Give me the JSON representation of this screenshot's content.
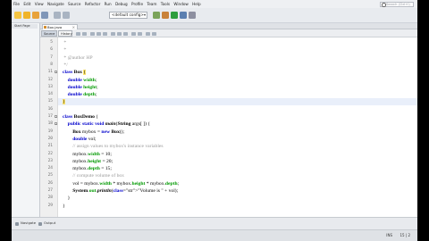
{
  "menu": [
    "File",
    "Edit",
    "View",
    "Navigate",
    "Source",
    "Refactor",
    "Run",
    "Debug",
    "Profile",
    "Team",
    "Tools",
    "Window",
    "Help"
  ],
  "search_placeholder": "Search (Ctrl+I)",
  "toolbar": {
    "config": "<default config>"
  },
  "left_panel": {
    "start_tab": "Start Page",
    "navigator_tab": "Navigator"
  },
  "file_tab": {
    "name": "Box.java",
    "close": "×"
  },
  "editor_tabs": {
    "source": "Source",
    "history": "History"
  },
  "lines": [
    {
      "n": "5",
      "fold": "",
      "html": " *"
    },
    {
      "n": "6",
      "fold": "",
      "html": " *"
    },
    {
      "n": "7",
      "fold": "",
      "html": " * @author HP"
    },
    {
      "n": "8",
      "fold": "",
      "html": " */"
    },
    {
      "n": "11",
      "fold": "−",
      "html": "class Box {"
    },
    {
      "n": "12",
      "fold": "",
      "html": "    double width;"
    },
    {
      "n": "13",
      "fold": "",
      "html": "    double height;"
    },
    {
      "n": "14",
      "fold": "",
      "html": "    double depth;"
    },
    {
      "n": "15",
      "fold": "",
      "html": "}"
    },
    {
      "n": "16",
      "fold": "",
      "html": ""
    },
    {
      "n": "17",
      "fold": "−",
      "html": "class BoxDemo {"
    },
    {
      "n": "18",
      "fold": "−",
      "html": "    public static void main(String args[ ]) {"
    },
    {
      "n": "19",
      "fold": "",
      "html": "        Box mybox = new Box();"
    },
    {
      "n": "20",
      "fold": "",
      "html": "        double vol;"
    },
    {
      "n": "21",
      "fold": "",
      "html": "        // assign values to mybox's instance variables"
    },
    {
      "n": "22",
      "fold": "",
      "html": "        mybox.width = 10;"
    },
    {
      "n": "23",
      "fold": "",
      "html": "        mybox.height = 20;"
    },
    {
      "n": "24",
      "fold": "",
      "html": "        mybox.depth = 15;"
    },
    {
      "n": "25",
      "fold": "",
      "html": "        // compute volume of box"
    },
    {
      "n": "26",
      "fold": "",
      "html": "        vol = mybox.width * mybox.height * mybox.depth;"
    },
    {
      "n": "27",
      "fold": "",
      "html": "        System.out.println(\"Volume is \" + vol);"
    },
    {
      "n": "28",
      "fold": "",
      "html": "    }"
    },
    {
      "n": "29",
      "fold": "",
      "html": "}"
    }
  ],
  "bottom": {
    "navigator": "Navigate",
    "output": "Output"
  },
  "status": {
    "mode": "INS",
    "position": "15 | 2"
  }
}
